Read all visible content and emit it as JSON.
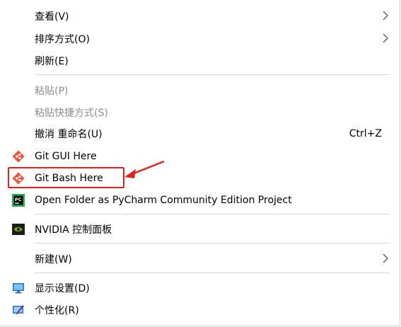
{
  "menu": {
    "items": [
      {
        "label": "查看(V)"
      },
      {
        "label": "排序方式(O)"
      },
      {
        "label": "刷新(E)"
      },
      {
        "label": "粘贴(P)"
      },
      {
        "label": "粘贴快捷方式(S)"
      },
      {
        "label": "撤消 重命名(U)",
        "shortcut": "Ctrl+Z"
      },
      {
        "label": "Git GUI Here"
      },
      {
        "label": "Git Bash Here"
      },
      {
        "label": "Open Folder as PyCharm Community Edition Project"
      },
      {
        "label": "NVIDIA 控制面板"
      },
      {
        "label": "新建(W)"
      },
      {
        "label": "显示设置(D)"
      },
      {
        "label": "个性化(R)"
      }
    ]
  },
  "colors": {
    "annotation": "#e51f1f",
    "disabled_text": "#8e8e8e",
    "separator": "#d4d4d4"
  }
}
